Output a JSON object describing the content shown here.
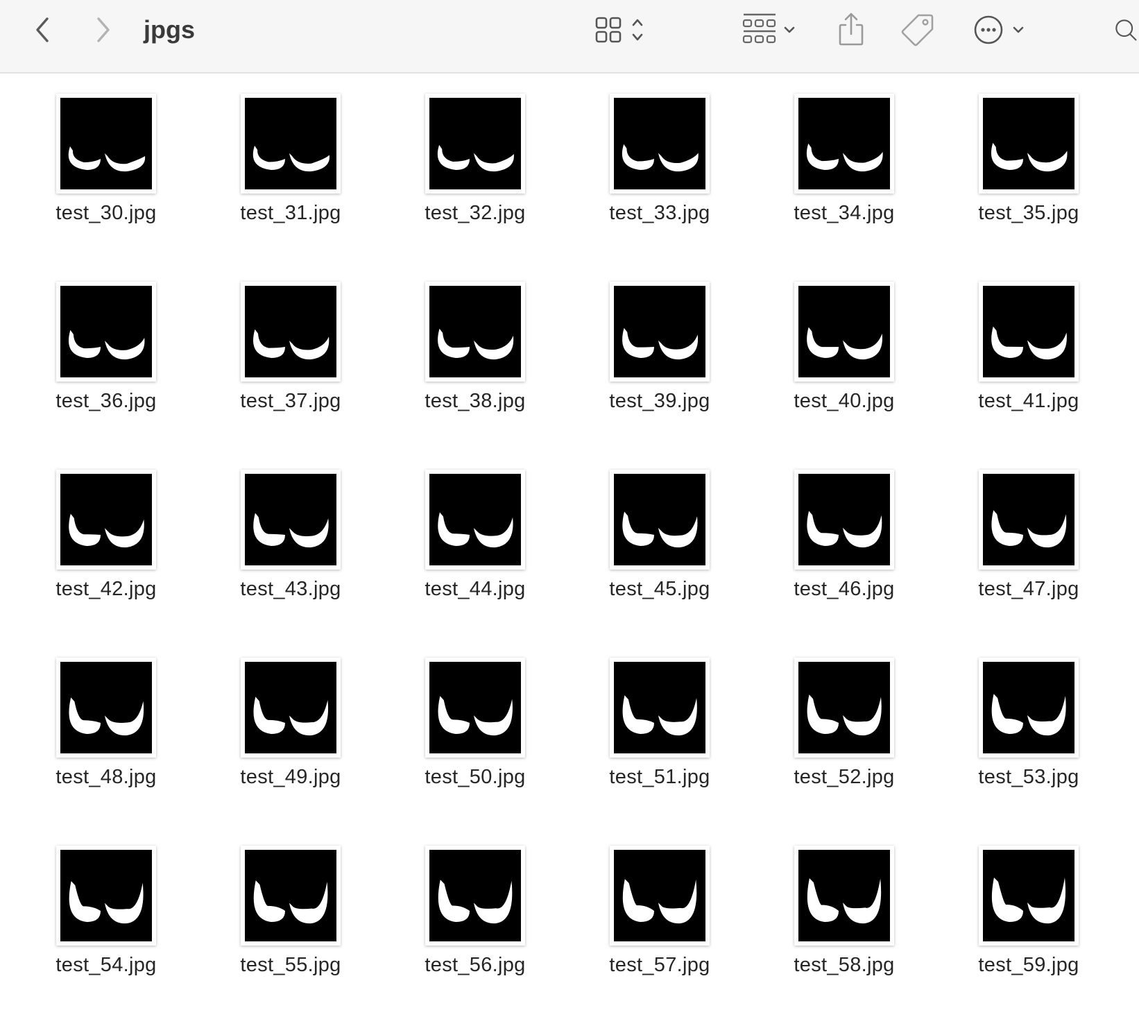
{
  "toolbar": {
    "back_icon": "chevron-left-icon",
    "forward_icon": "chevron-right-icon",
    "folder_title": "jpgs",
    "view_icon": "grid-view-icon",
    "group_icon": "group-by-icon",
    "share_icon": "share-icon",
    "tag_icon": "tag-icon",
    "more_icon": "ellipsis-circle-icon",
    "search_icon": "search-icon"
  },
  "files": [
    {
      "name": "test_30.jpg"
    },
    {
      "name": "test_31.jpg"
    },
    {
      "name": "test_32.jpg"
    },
    {
      "name": "test_33.jpg"
    },
    {
      "name": "test_34.jpg"
    },
    {
      "name": "test_35.jpg"
    },
    {
      "name": "test_36.jpg"
    },
    {
      "name": "test_37.jpg"
    },
    {
      "name": "test_38.jpg"
    },
    {
      "name": "test_39.jpg"
    },
    {
      "name": "test_40.jpg"
    },
    {
      "name": "test_41.jpg"
    },
    {
      "name": "test_42.jpg"
    },
    {
      "name": "test_43.jpg"
    },
    {
      "name": "test_44.jpg"
    },
    {
      "name": "test_45.jpg"
    },
    {
      "name": "test_46.jpg"
    },
    {
      "name": "test_47.jpg"
    },
    {
      "name": "test_48.jpg"
    },
    {
      "name": "test_49.jpg"
    },
    {
      "name": "test_50.jpg"
    },
    {
      "name": "test_51.jpg"
    },
    {
      "name": "test_52.jpg"
    },
    {
      "name": "test_53.jpg"
    },
    {
      "name": "test_54.jpg"
    },
    {
      "name": "test_55.jpg"
    },
    {
      "name": "test_56.jpg"
    },
    {
      "name": "test_57.jpg"
    },
    {
      "name": "test_58.jpg"
    },
    {
      "name": "test_59.jpg"
    }
  ]
}
